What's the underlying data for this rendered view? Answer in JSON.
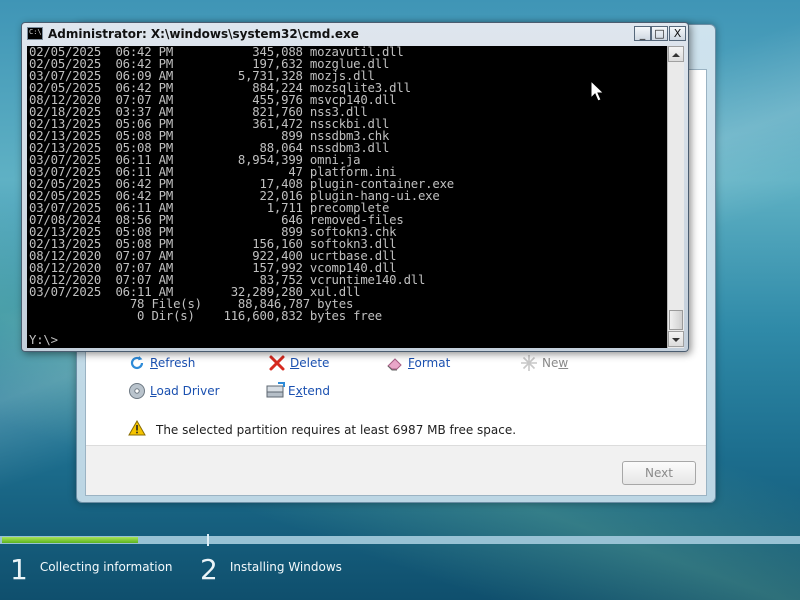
{
  "cmd": {
    "title": "Administrator: X:\\windows\\system32\\cmd.exe",
    "minimize_label": "_",
    "maximize_label": "□",
    "close_label": "X",
    "lines": [
      "02/05/2025  06:42 PM           345,088 mozavutil.dll",
      "02/05/2025  06:42 PM           197,632 mozglue.dll",
      "03/07/2025  06:09 AM         5,731,328 mozjs.dll",
      "02/05/2025  06:42 PM           884,224 mozsqlite3.dll",
      "08/12/2020  07:07 AM           455,976 msvcp140.dll",
      "02/18/2025  03:37 AM           821,760 nss3.dll",
      "02/13/2025  05:06 PM           361,472 nssckbi.dll",
      "02/13/2025  05:08 PM               899 nssdbm3.chk",
      "02/13/2025  05:08 PM            88,064 nssdbm3.dll",
      "03/07/2025  06:11 AM         8,954,399 omni.ja",
      "03/07/2025  06:11 AM                47 platform.ini",
      "02/05/2025  06:42 PM            17,408 plugin-container.exe",
      "02/05/2025  06:42 PM            22,016 plugin-hang-ui.exe",
      "03/07/2025  06:11 AM             1,711 precomplete",
      "07/08/2024  08:56 PM               646 removed-files",
      "02/13/2025  05:08 PM               899 softokn3.chk",
      "02/13/2025  05:08 PM           156,160 softokn3.dll",
      "08/12/2020  07:07 AM           922,400 ucrtbase.dll",
      "08/12/2020  07:07 AM           157,992 vcomp140.dll",
      "08/12/2020  07:07 AM            83,752 vcruntime140.dll",
      "03/07/2025  06:11 AM        32,289,280 xul.dll",
      "              78 File(s)     88,846,787 bytes",
      "               0 Dir(s)    116,600,832 bytes free"
    ],
    "prompt": "Y:\\>"
  },
  "setup": {
    "actions": {
      "refresh": "Refresh",
      "delete": "Delete",
      "format": "Format",
      "new": "New",
      "load_driver": "Load Driver",
      "extend": "Extend"
    },
    "warning": "The selected partition requires at least 6987 MB free space.",
    "next_label": "Next"
  },
  "progress": {
    "stages": [
      {
        "number": "1",
        "label": "Collecting information"
      },
      {
        "number": "2",
        "label": "Installing Windows"
      }
    ],
    "stage1_fraction": 0.17
  },
  "colors": {
    "link": "#1a50b0",
    "disabled": "#8a8a8a",
    "progress_green": "#5cb41f"
  }
}
